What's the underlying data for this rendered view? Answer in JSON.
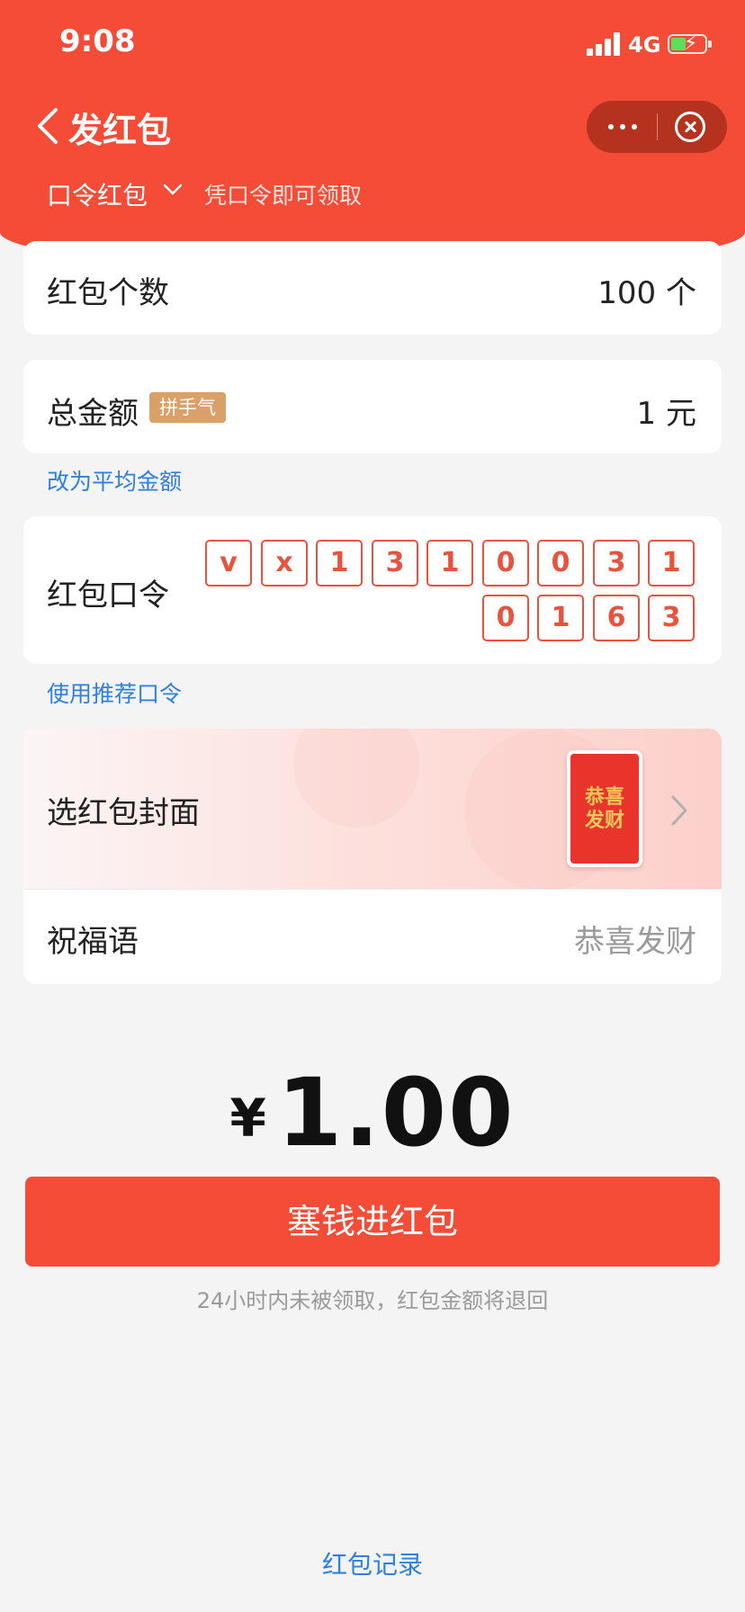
{
  "status_bar": {
    "time": "9:08",
    "network": "4G"
  },
  "nav": {
    "title": "发红包",
    "more_icon": "more-dots-icon",
    "close_icon": "close-circle-icon"
  },
  "packet_type": {
    "label": "口令红包",
    "hint": "凭口令即可领取"
  },
  "count": {
    "label": "红包个数",
    "value": "100 个"
  },
  "total": {
    "label": "总金额",
    "badge": "拼手气",
    "value": "1 元"
  },
  "switch_average_link": "改为平均金额",
  "password": {
    "label": "红包口令",
    "chars_row1": [
      "v",
      "x",
      "1",
      "3",
      "1",
      "0",
      "0",
      "3",
      "1"
    ],
    "chars_row2": [
      "0",
      "1",
      "6",
      "3"
    ]
  },
  "recommend_link": "使用推荐口令",
  "cover": {
    "label": "选红包封面",
    "thumb_text_line1": "恭喜",
    "thumb_text_line2": "发财"
  },
  "blessing": {
    "label": "祝福语",
    "placeholder": "恭喜发财"
  },
  "amount": {
    "currency": "¥",
    "value": "1.00"
  },
  "submit_label": "塞钱进红包",
  "refund_hint": "24小时内未被领取，红包金额将退回",
  "records_link": "红包记录",
  "colors": {
    "brand_red": "#f44c37",
    "link_blue": "#2d7fe0",
    "badge_gold": "#d9a068"
  }
}
